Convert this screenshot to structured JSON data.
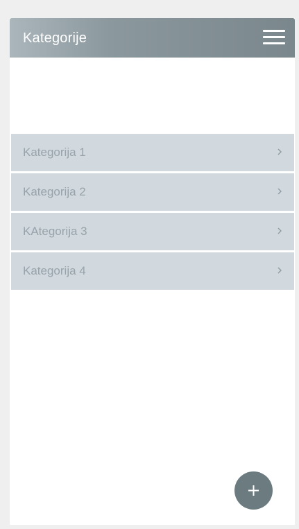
{
  "appbar": {
    "title": "Kategorije",
    "menu_icon": "hamburger-menu-icon"
  },
  "categories": [
    {
      "label": "Kategorija 1",
      "icon": "chevron-right-icon"
    },
    {
      "label": "Kategorija 2",
      "icon": "chevron-right-icon"
    },
    {
      "label": "KAtegorija 3",
      "icon": "chevron-right-icon"
    },
    {
      "label": "Kategorija 4",
      "icon": "chevron-right-icon"
    }
  ],
  "fab": {
    "icon": "plus-icon"
  },
  "colors": {
    "appbar_gradient_start": "#aab6bb",
    "appbar_gradient_end": "#7a878c",
    "list_item_bg": "#d1d9df",
    "list_item_text": "#97a2a9",
    "fab_bg": "#6c7b80",
    "page_bg": "#efefef"
  }
}
